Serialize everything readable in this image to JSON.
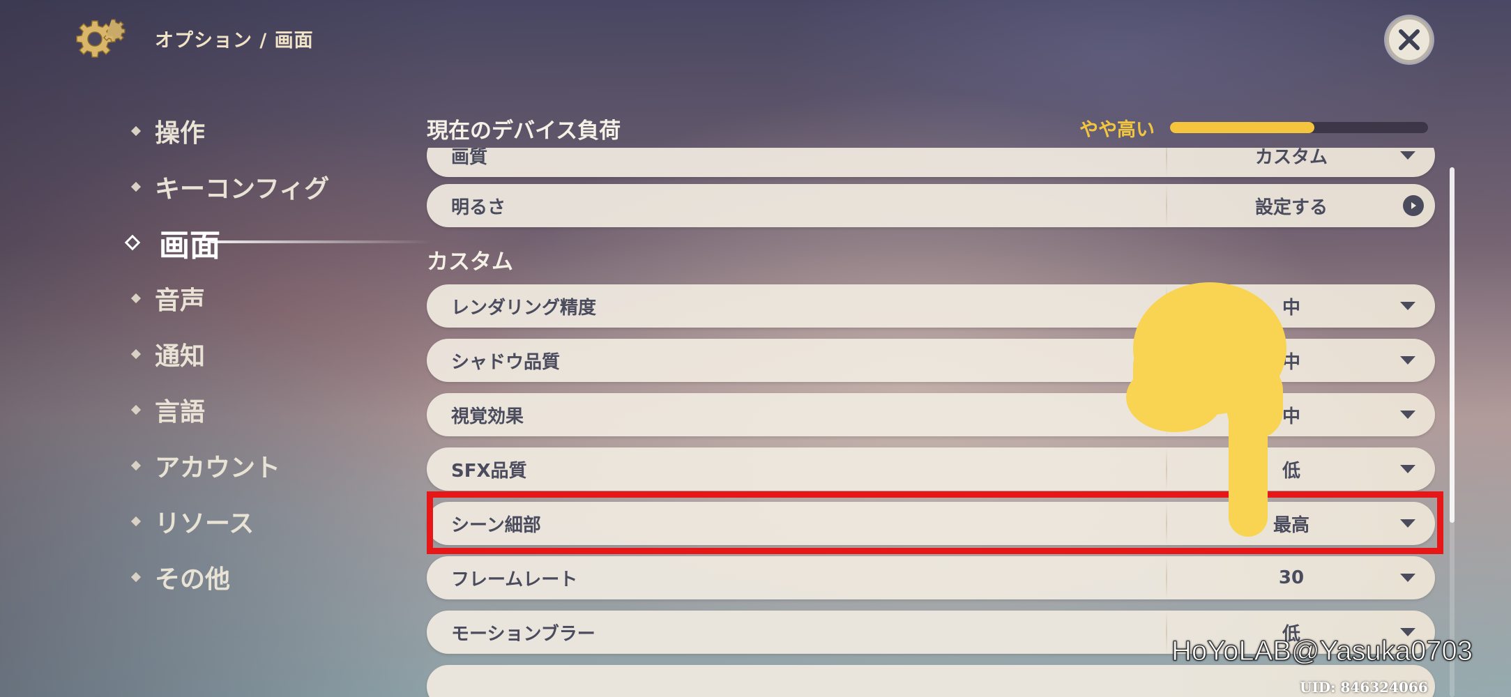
{
  "header": {
    "breadcrumb": "オプション / 画面",
    "gear_icon": "gear-icon",
    "close_icon": "close-icon"
  },
  "sidebar": {
    "items": [
      {
        "label": "操作",
        "active": false
      },
      {
        "label": "キーコンフィグ",
        "active": false
      },
      {
        "label": "画面",
        "active": true
      },
      {
        "label": "音声",
        "active": false
      },
      {
        "label": "通知",
        "active": false
      },
      {
        "label": "言語",
        "active": false
      },
      {
        "label": "アカウント",
        "active": false
      },
      {
        "label": "リソース",
        "active": false
      },
      {
        "label": "その他",
        "active": false
      }
    ]
  },
  "device_load": {
    "title": "現在のデバイス負荷",
    "level_label": "やや高い",
    "level_fraction": 0.56,
    "color": "#f6c53e"
  },
  "settings": {
    "partial_row": {
      "label": "画質",
      "value": "カスタム"
    },
    "brightness": {
      "label": "明るさ",
      "value": "設定する"
    },
    "custom_section_title": "カスタム",
    "rows": [
      {
        "label": "レンダリング精度",
        "value": "中"
      },
      {
        "label": "シャドウ品質",
        "value": "中"
      },
      {
        "label": "視覚効果",
        "value": "中"
      },
      {
        "label": "SFX品質",
        "value": "低"
      },
      {
        "label": "シーン細部",
        "value": "最高",
        "highlighted": true
      },
      {
        "label": "フレームレート",
        "value": "30"
      },
      {
        "label": "モーションブラー",
        "value": "低"
      }
    ]
  },
  "annotation": {
    "highlight_color": "#e81717",
    "pointer_color": "#f8d452"
  },
  "watermark": {
    "text": "HoYoLAB@Yasuka0703",
    "uid": "UID: 846324066"
  }
}
